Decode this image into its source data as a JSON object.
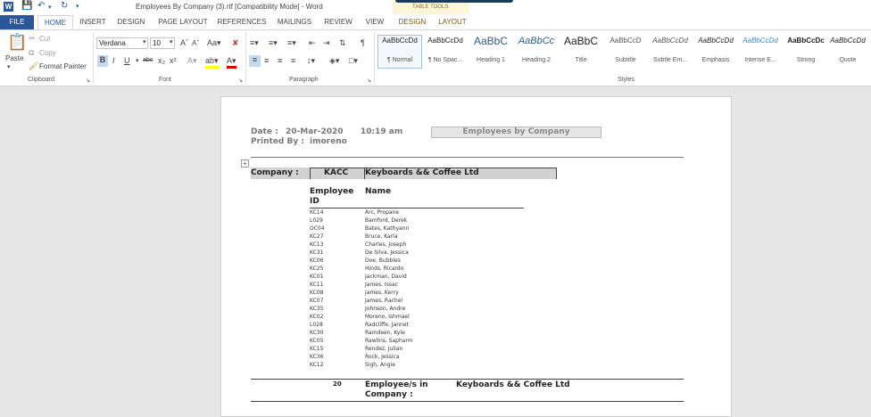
{
  "window": {
    "title": "Employees By Company (3).rtf [Compatibility Mode] - Word",
    "app_icon": "W",
    "table_tools": "TABLE TOOLS"
  },
  "tabs": [
    {
      "label": "FILE"
    },
    {
      "label": "HOME"
    },
    {
      "label": "INSERT"
    },
    {
      "label": "DESIGN"
    },
    {
      "label": "PAGE LAYOUT"
    },
    {
      "label": "REFERENCES"
    },
    {
      "label": "MAILINGS"
    },
    {
      "label": "REVIEW"
    },
    {
      "label": "VIEW"
    },
    {
      "label": "DESIGN"
    },
    {
      "label": "LAYOUT"
    }
  ],
  "clipboard": {
    "paste": "Paste",
    "cut": "Cut",
    "copy": "Copy",
    "format_painter": "Format Painter",
    "group": "Clipboard"
  },
  "font": {
    "name": "Verdana",
    "size": "10",
    "group": "Font"
  },
  "paragraph": {
    "group": "Paragraph"
  },
  "styles": {
    "group": "Styles",
    "items": [
      {
        "sample": "AaBbCcDd",
        "name": "¶ Normal"
      },
      {
        "sample": "AaBbCcDd",
        "name": "¶ No Spac..."
      },
      {
        "sample": "AaBbC",
        "name": "Heading 1"
      },
      {
        "sample": "AaBbCc",
        "name": "Heading 2"
      },
      {
        "sample": "AaBbC",
        "name": "Title"
      },
      {
        "sample": "AaBbCcD",
        "name": "Subtitle"
      },
      {
        "sample": "AaBbCcDd",
        "name": "Subtle Em..."
      },
      {
        "sample": "AaBbCcDd",
        "name": "Emphasis"
      },
      {
        "sample": "AaBbCcDd",
        "name": "Intense E..."
      },
      {
        "sample": "AaBbCcDc",
        "name": "Strong"
      },
      {
        "sample": "AaBbCcDd",
        "name": "Quote"
      }
    ]
  },
  "report": {
    "date_label": "Date :",
    "date": "20-Mar-2020",
    "time": "10:19 am",
    "printed_label": "Printed By :",
    "printed_by": "imoreno",
    "title": "Employees by Company",
    "company_label": "Company :",
    "company_code": "KACC",
    "company_name": "Keyboards && Coffee Ltd",
    "col_id": "Employee ID",
    "col_name": "Name",
    "employees": [
      {
        "id": "KC14",
        "name": "Arc, Propane"
      },
      {
        "id": "L029",
        "name": "Bamford, Derek"
      },
      {
        "id": "OC04",
        "name": "Bates, Kathyann"
      },
      {
        "id": "KC27",
        "name": "Bruce, Karla"
      },
      {
        "id": "KC13",
        "name": "Charles, Joseph"
      },
      {
        "id": "KC31",
        "name": "De Silva, Jessica"
      },
      {
        "id": "KC06",
        "name": "Doe, Bubbles"
      },
      {
        "id": "KC25",
        "name": "Hinds, Ricardo"
      },
      {
        "id": "KC01",
        "name": "Jackman, David"
      },
      {
        "id": "KC11",
        "name": "James, Issac"
      },
      {
        "id": "KC08",
        "name": "James, Kerry"
      },
      {
        "id": "KC07",
        "name": "James, Rachel"
      },
      {
        "id": "KC35",
        "name": "Johnson, Andre"
      },
      {
        "id": "KC02",
        "name": "Moreno, Ishmael"
      },
      {
        "id": "L028",
        "name": "Radcliffe, Jannet"
      },
      {
        "id": "KC30",
        "name": "Ramdeen, Kyle"
      },
      {
        "id": "KC05",
        "name": "Rawlins, Sapharm"
      },
      {
        "id": "KC15",
        "name": "Rendez, Julian"
      },
      {
        "id": "KC36",
        "name": "Rock, Jessica"
      },
      {
        "id": "KC12",
        "name": "Sigh, Angie"
      }
    ],
    "count": "20",
    "footer_label": "Employee/s in Company :",
    "footer_company": "Keyboards && Coffee Ltd"
  }
}
